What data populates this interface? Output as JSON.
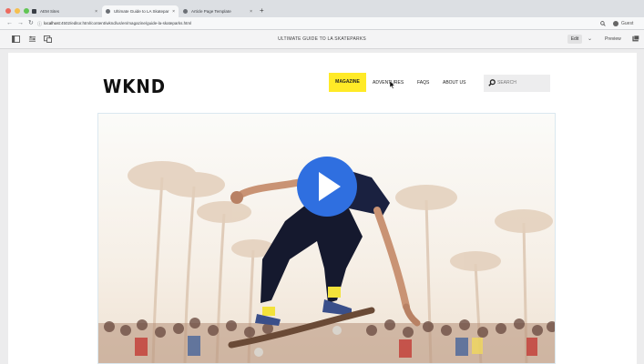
{
  "browser": {
    "tabs": [
      {
        "label": "AEM Sites"
      },
      {
        "label": "Ultimate Guide to LA Skatepar"
      },
      {
        "label": "Article Page Template"
      }
    ],
    "url_host": "localhost",
    "url_rest": ":4502/editor.html/content/wknd/us/en/magazine/guide-la-skateparks.html",
    "guest_label": "Guest"
  },
  "editor": {
    "page_title": "ULTIMATE GUIDE TO LA SKATEPARKS",
    "edit_label": "Edit",
    "preview_label": "Preview"
  },
  "site": {
    "logo": "WKND",
    "nav": {
      "magazine": "MAGAZINE",
      "adventures": "ADVENTURES",
      "faqs": "FAQS",
      "about": "ABOUT US"
    },
    "search_placeholder": "SEARCH"
  },
  "colors": {
    "accent_yellow": "#ffea27",
    "play_button": "#2f6fe0"
  }
}
